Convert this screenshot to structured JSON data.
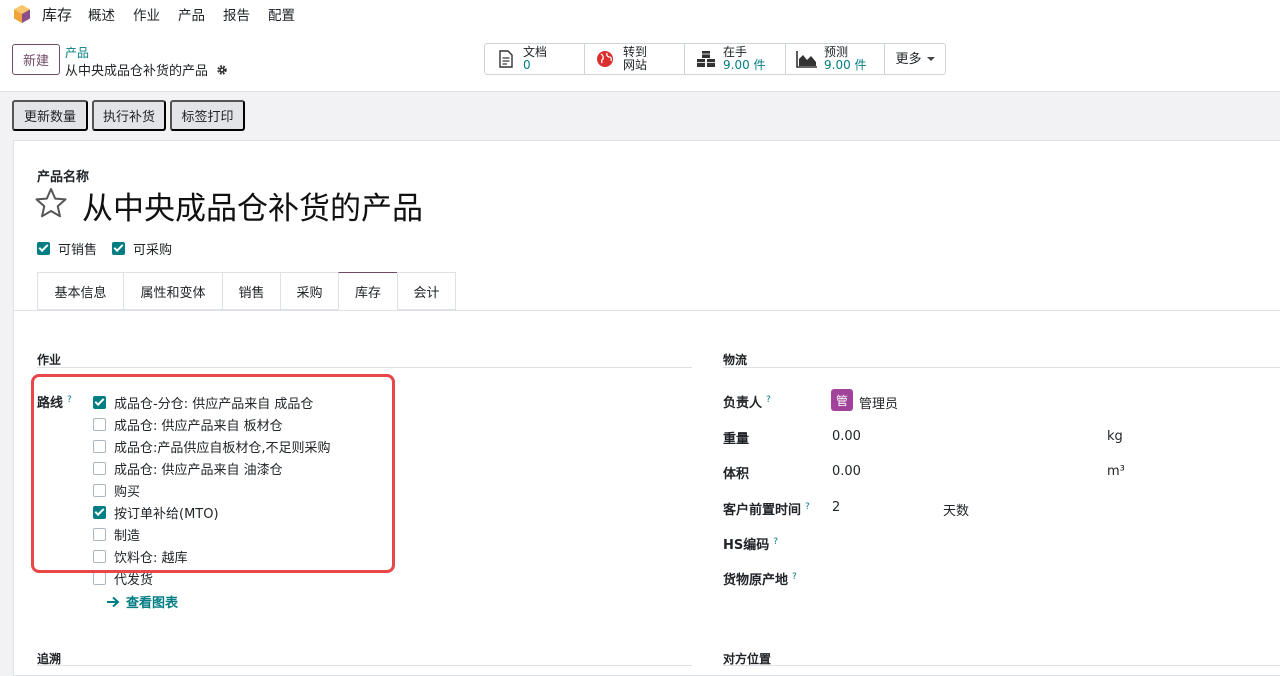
{
  "app": {
    "name": "库存"
  },
  "menu": [
    "概述",
    "作业",
    "产品",
    "报告",
    "配置"
  ],
  "control": {
    "new_label": "新建",
    "breadcrumb_parent": "产品",
    "breadcrumb_current": "从中央成品仓补货的产品"
  },
  "stats": {
    "docs": {
      "label": "文档",
      "value": "0"
    },
    "website": {
      "label": "转到",
      "value": "网站"
    },
    "onhand": {
      "label": "在手",
      "value": "9.00 件"
    },
    "forecast": {
      "label": "预测",
      "value": "9.00 件"
    },
    "more": "更多"
  },
  "actions": [
    "更新数量",
    "执行补货",
    "标签打印"
  ],
  "form": {
    "name_label": "产品名称",
    "name": "从中央成品仓补货的产品",
    "can_sell": "可销售",
    "can_purchase": "可采购",
    "tabs": [
      "基本信息",
      "属性和变体",
      "销售",
      "采购",
      "库存",
      "会计"
    ],
    "active_tab": "库存"
  },
  "operations": {
    "title": "作业",
    "routes_label": "路线",
    "routes": [
      {
        "label": "成品仓-分仓: 供应产品来自 成品仓",
        "checked": true
      },
      {
        "label": "成品仓: 供应产品来自 板材仓",
        "checked": false
      },
      {
        "label": "成品仓:产品供应自板材仓,不足则采购",
        "checked": false
      },
      {
        "label": "成品仓: 供应产品来自 油漆仓",
        "checked": false
      },
      {
        "label": "购买",
        "checked": false
      },
      {
        "label": "按订单补给(MTO)",
        "checked": true
      },
      {
        "label": "制造",
        "checked": false
      },
      {
        "label": "饮料仓: 越库",
        "checked": false
      },
      {
        "label": "代发货",
        "checked": false
      }
    ],
    "view_diagram": "查看图表"
  },
  "logistics": {
    "title": "物流",
    "responsible_label": "负责人",
    "responsible_avatar": "管",
    "responsible": "管理员",
    "weight_label": "重量",
    "weight": "0.00",
    "weight_unit": "kg",
    "volume_label": "体积",
    "volume": "0.00",
    "volume_unit": "m³",
    "lead_label": "客户前置时间",
    "lead": "2",
    "lead_unit": "天数",
    "hs_label": "HS编码",
    "origin_label": "货物原产地"
  },
  "traceability": {
    "title": "追溯"
  },
  "counterpart": {
    "title": "对方位置"
  },
  "colors": {
    "brand": "#714b67",
    "accent": "#017e84",
    "highlight": "#e8474a"
  }
}
